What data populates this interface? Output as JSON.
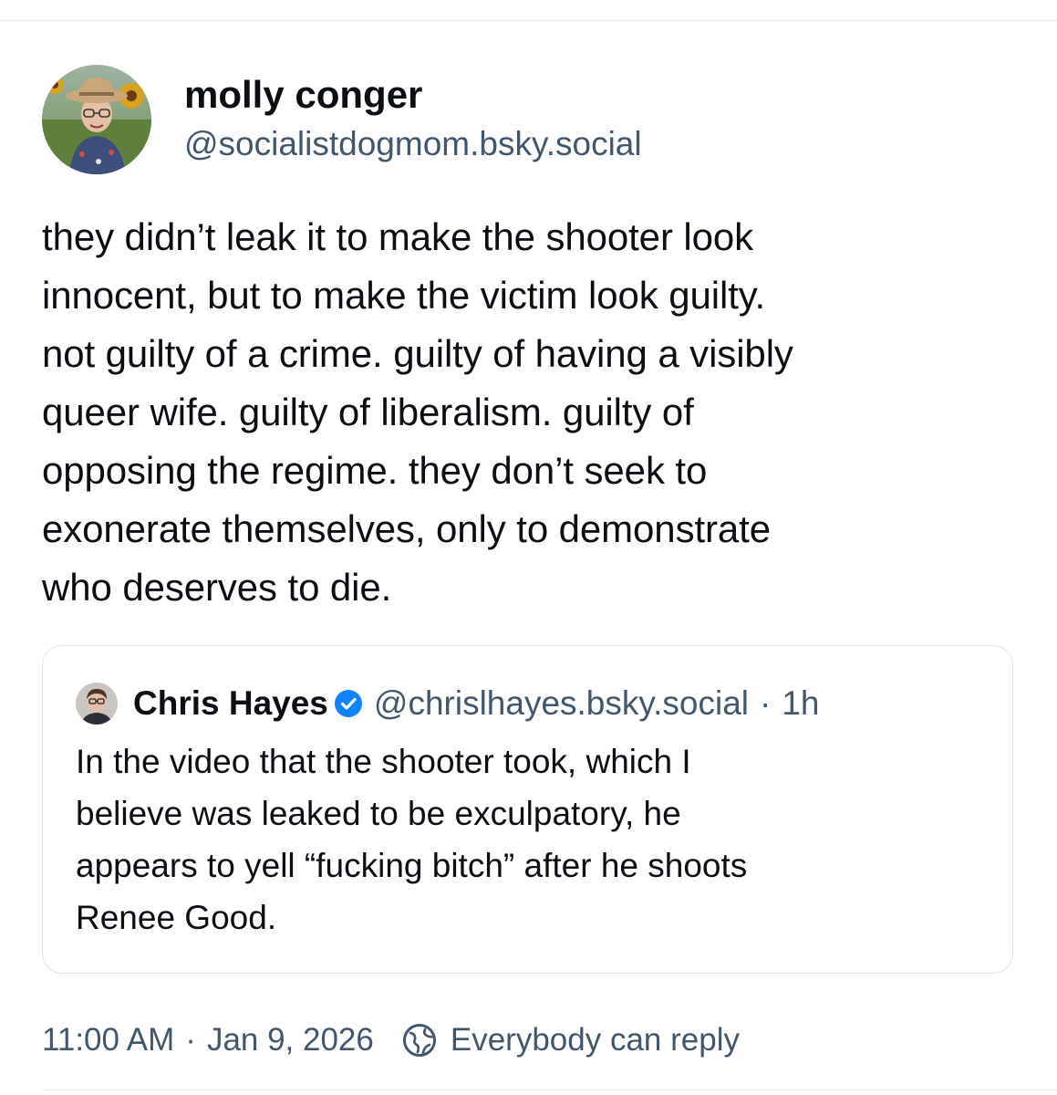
{
  "post": {
    "author": {
      "display_name": "molly conger",
      "handle": "@socialistdogmom.bsky.social",
      "avatar_icon": "avatar-photo"
    },
    "text_lines": [
      "they didn’t leak it to make the shooter look",
      "innocent, but to make the victim look guilty.",
      "not guilty of a crime. guilty of having a visibly",
      "queer wife. guilty of liberalism. guilty of",
      "opposing the regime. they don’t seek to",
      "exonerate themselves, only to demonstrate",
      "who deserves to die."
    ],
    "quote": {
      "display_name": "Chris Hayes",
      "verified_icon": "verified-check-icon",
      "handle": "@chrislhayes.bsky.social",
      "separator": "·",
      "time": "1h",
      "text_lines": [
        "In the video that the shooter took, which I",
        "believe was leaked to be exculpatory, he",
        "appears to yell “fucking bitch” after he shoots",
        "Renee Good."
      ]
    },
    "meta": {
      "time": "11:00 AM",
      "separator": "·",
      "date": "Jan 9, 2026",
      "reply_icon": "globe-reply-icon",
      "reply_setting": "Everybody can reply"
    }
  },
  "colors": {
    "text": "#0b0f14",
    "muted": "#42576c",
    "verified": "#1083fe",
    "border": "#dfe3e8"
  }
}
